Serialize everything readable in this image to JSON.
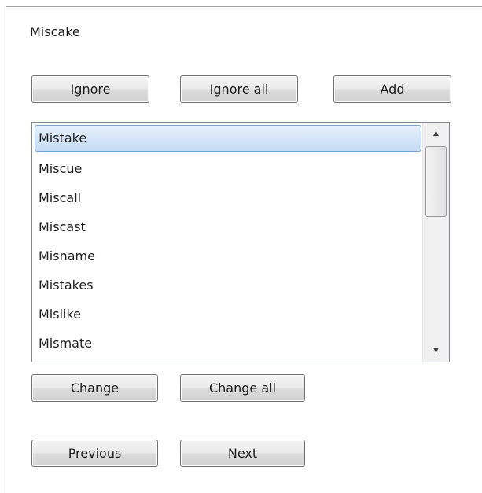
{
  "misspelled_word": "Miscake",
  "buttons": {
    "ignore": "Ignore",
    "ignore_all": "Ignore all",
    "add": "Add",
    "change": "Change",
    "change_all": "Change all",
    "previous": "Previous",
    "next": "Next"
  },
  "suggestions": {
    "items": [
      "Mistake",
      "Miscue",
      "Miscall",
      "Miscast",
      "Misname",
      "Mistakes",
      "Mislike",
      "Mismate"
    ],
    "selected": "Mistake"
  },
  "scrollbar": {
    "up_icon": "triangle-up-icon",
    "down_icon": "triangle-down-icon"
  }
}
